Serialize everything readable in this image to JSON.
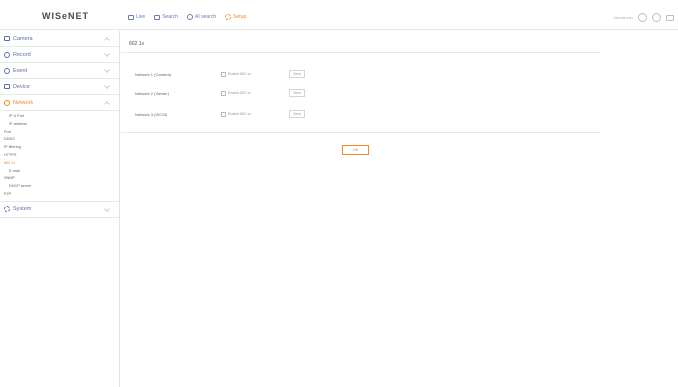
{
  "brand": {
    "logo": "WISeNET"
  },
  "nav": [
    {
      "label": "Live",
      "icon": "live-icon",
      "active": false
    },
    {
      "label": "Search",
      "icon": "search-icon",
      "active": false
    },
    {
      "label": "AI search",
      "icon": "ai-search-icon",
      "active": false
    },
    {
      "label": "Setup",
      "icon": "setup-icon",
      "active": true
    }
  ],
  "toolbar": {
    "user_text": "Normal user"
  },
  "sidebar": {
    "groups": [
      {
        "label": "Camera"
      },
      {
        "label": "Record"
      },
      {
        "label": "Event"
      },
      {
        "label": "Device"
      },
      {
        "label": "Network"
      },
      {
        "label": "System"
      }
    ],
    "network_items": [
      "IP & Port",
      "IP address",
      "Port",
      "DDNS",
      "IP filtering",
      "HTTPS",
      "802.1x",
      "E-mail",
      "SNMP",
      "DHCP server",
      "P2P"
    ]
  },
  "page": {
    "title": "802.1x",
    "rows": [
      {
        "label": "Network 1 (Camera)",
        "checkbox": "Enable 802.1x",
        "button": "View"
      },
      {
        "label": "Network 2 (Viewer)",
        "checkbox": "Enable 802.1x",
        "button": "View"
      },
      {
        "label": "Network 3 (ISCSI)",
        "checkbox": "Enable 802.1x",
        "button": "View"
      }
    ],
    "ok_label": "OK"
  },
  "colors": {
    "accent": "#f08a28",
    "nav_blue": "#6a7eb0"
  }
}
